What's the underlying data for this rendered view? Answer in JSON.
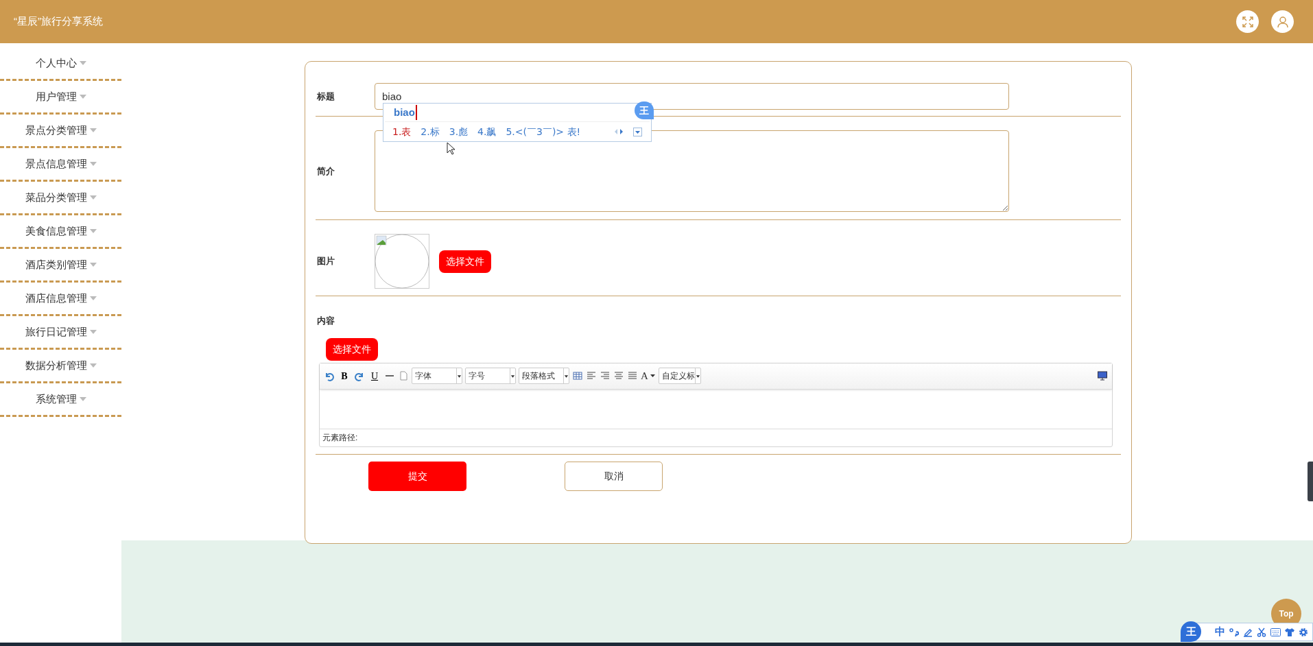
{
  "header": {
    "title": "“星辰”旅行分享系统"
  },
  "sidebar": {
    "items": [
      {
        "label": "个人中心"
      },
      {
        "label": "用户管理"
      },
      {
        "label": "景点分类管理"
      },
      {
        "label": "景点信息管理"
      },
      {
        "label": "菜品分类管理"
      },
      {
        "label": "美食信息管理"
      },
      {
        "label": "酒店类别管理"
      },
      {
        "label": "酒店信息管理"
      },
      {
        "label": "旅行日记管理"
      },
      {
        "label": "数据分析管理"
      },
      {
        "label": "系统管理"
      }
    ]
  },
  "form": {
    "title_label": "标题",
    "title_value": "biao",
    "intro_label": "简介",
    "image_label": "图片",
    "image_button": "选择文件",
    "content_label": "内容",
    "content_button": "选择文件",
    "editor": {
      "bold": "B",
      "underline": "U",
      "font_family": "字体",
      "font_size": "字号",
      "paragraph": "段落格式",
      "font_color": "A",
      "custom_heading": "自定义标",
      "path_label": "元素路径:"
    },
    "submit": "提交",
    "cancel": "取消"
  },
  "ime_popup": {
    "composition": "biao",
    "logo": "王",
    "candidates": [
      {
        "text": "1.表",
        "selected": true
      },
      {
        "text": "2.标",
        "selected": false
      },
      {
        "text": "3.彪",
        "selected": false
      },
      {
        "text": "4.飙",
        "selected": false
      },
      {
        "text": "5.<(￣3￣)> 表!",
        "selected": false
      }
    ]
  },
  "ime_bar": {
    "logo": "王",
    "mode": "中"
  },
  "top_button": "Top"
}
